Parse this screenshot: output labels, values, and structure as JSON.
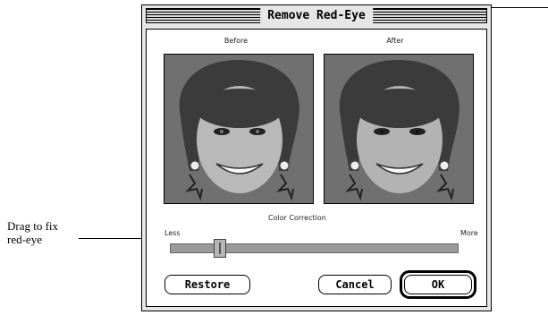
{
  "callout": {
    "text": "Drag to fix\nred-eye"
  },
  "dialog": {
    "title": "Remove Red-Eye",
    "before_label": "Before",
    "after_label": "After",
    "slider": {
      "label": "Color Correction",
      "min_label": "Less",
      "max_label": "More",
      "value_fraction": 0.16
    },
    "buttons": {
      "restore": "Restore",
      "cancel": "Cancel",
      "ok": "OK"
    }
  }
}
